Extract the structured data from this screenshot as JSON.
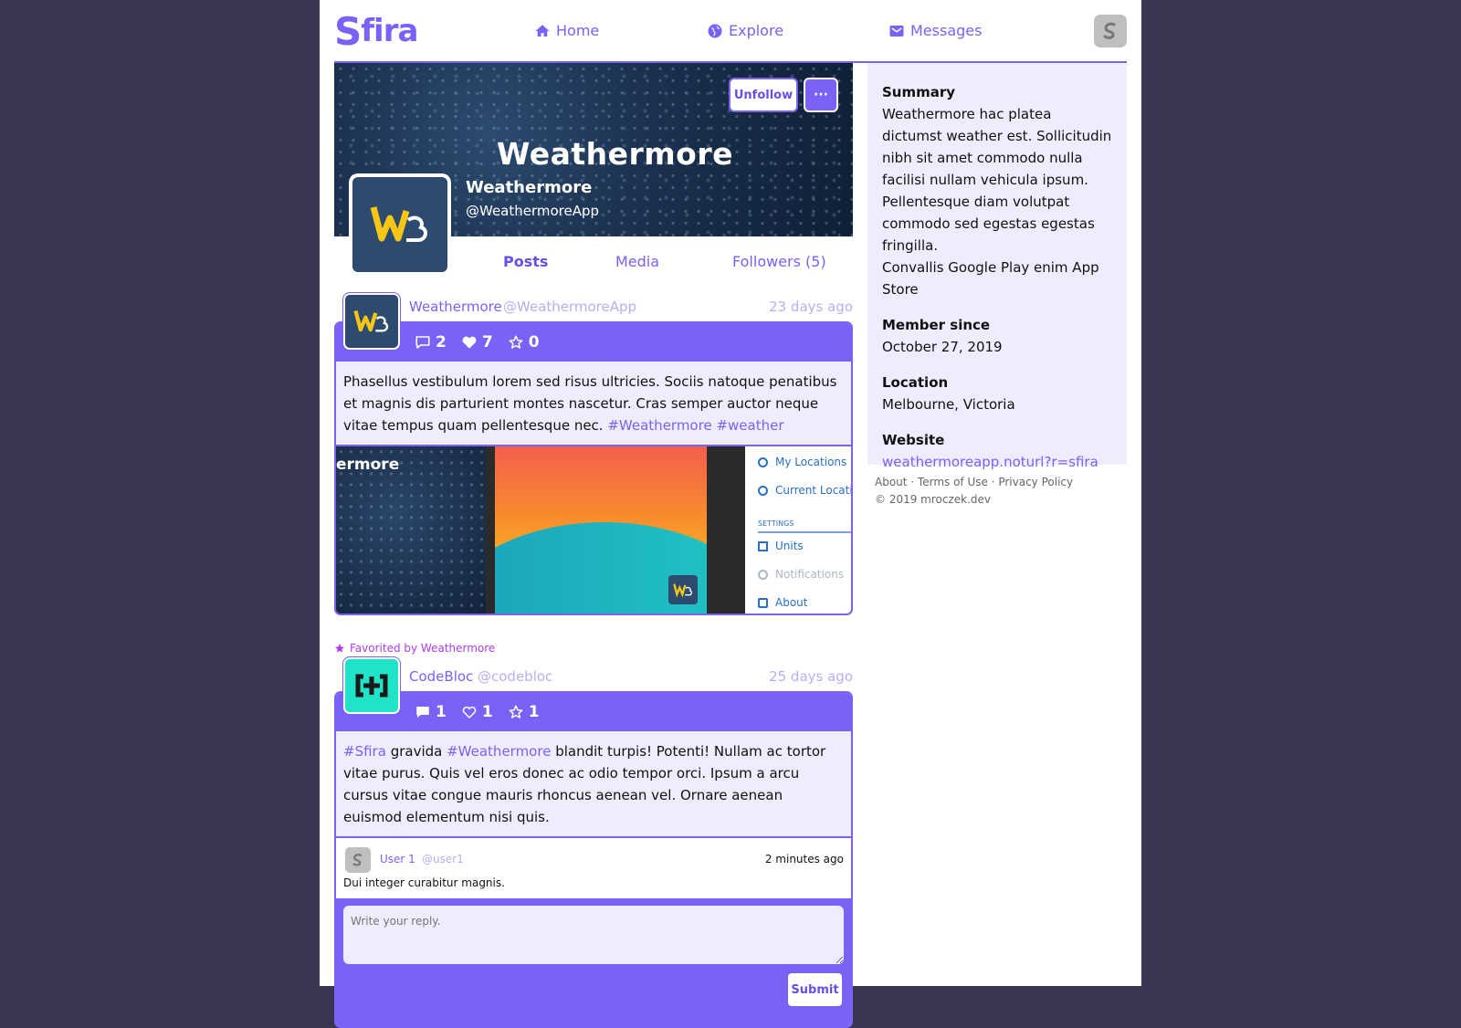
{
  "brand": {
    "name": "Sfira",
    "accent": "#7b61f5"
  },
  "nav": {
    "home": "Home",
    "explore": "Explore",
    "messages": "Messages"
  },
  "profile": {
    "cover_text": "Weathermore",
    "name": "Weathermore",
    "handle": "@WeathermoreApp",
    "unfollow_label": "Unfollow",
    "more_label": "···",
    "tabs": [
      "Posts",
      "Media",
      "Followers (5)"
    ]
  },
  "posts": [
    {
      "author": "Weathermore",
      "handle": "@WeathermoreApp",
      "time": "23 days ago",
      "comments": "2",
      "likes": "7",
      "favorites": "0",
      "text": "Phasellus vestibulum lorem sed risus ultricies. Sociis natoque penatibus et magnis dis parturient montes nascetur. Cras semper auctor neque vitae tempus quam pellentesque nec.",
      "tags": [
        "#Weathermore",
        "#weather"
      ],
      "image": {
        "brand_fragment": "ermore",
        "menu": [
          "My Locations (",
          "Current Locati",
          "SETTINGS",
          "Units",
          "Notifications",
          "About"
        ]
      }
    },
    {
      "favorited_by": "Favorited by Weathermore",
      "author": "CodeBloc",
      "handle": "@codebloc",
      "time": "25 days ago",
      "comments": "1",
      "likes": "1",
      "favorites": "1",
      "tag1": "#Sfira",
      "word1": "gravida",
      "tag2": "#Weathermore",
      "text_rest": "blandit turpis! Potenti! Nullam ac tortor vitae purus. Quis vel eros donec ac odio tempor orci. Ipsum a arcu cursus vitae congue mauris rhoncus aenean vel. Ornare aenean euismod elementum nisi quis.",
      "reply": {
        "author": "User 1",
        "handle": "@user1",
        "time": "2 minutes ago",
        "text": "Dui integer curabitur magnis."
      },
      "reply_placeholder": "Write your reply.",
      "submit_label": "Submit"
    }
  ],
  "sidebar": {
    "summary_label": "Summary",
    "summary_text": "Weathermore hac platea dictumst weather est. Sollicitudin nibh sit amet commodo nulla facilisi nullam vehicula ipsum. Pellentesque diam volutpat commodo sed egestas egestas fringilla.",
    "summary_text2": "Convallis Google Play enim App Store",
    "member_label": "Member since",
    "member_value": "October 27, 2019",
    "location_label": "Location",
    "location_value": "Melbourne, Victoria",
    "website_label": "Website",
    "website_value": "weathermoreapp.noturl?r=sfira"
  },
  "footer": {
    "links": "About · Terms of Use · Privacy Policy",
    "copyright": "© 2019 mroczek.dev"
  }
}
